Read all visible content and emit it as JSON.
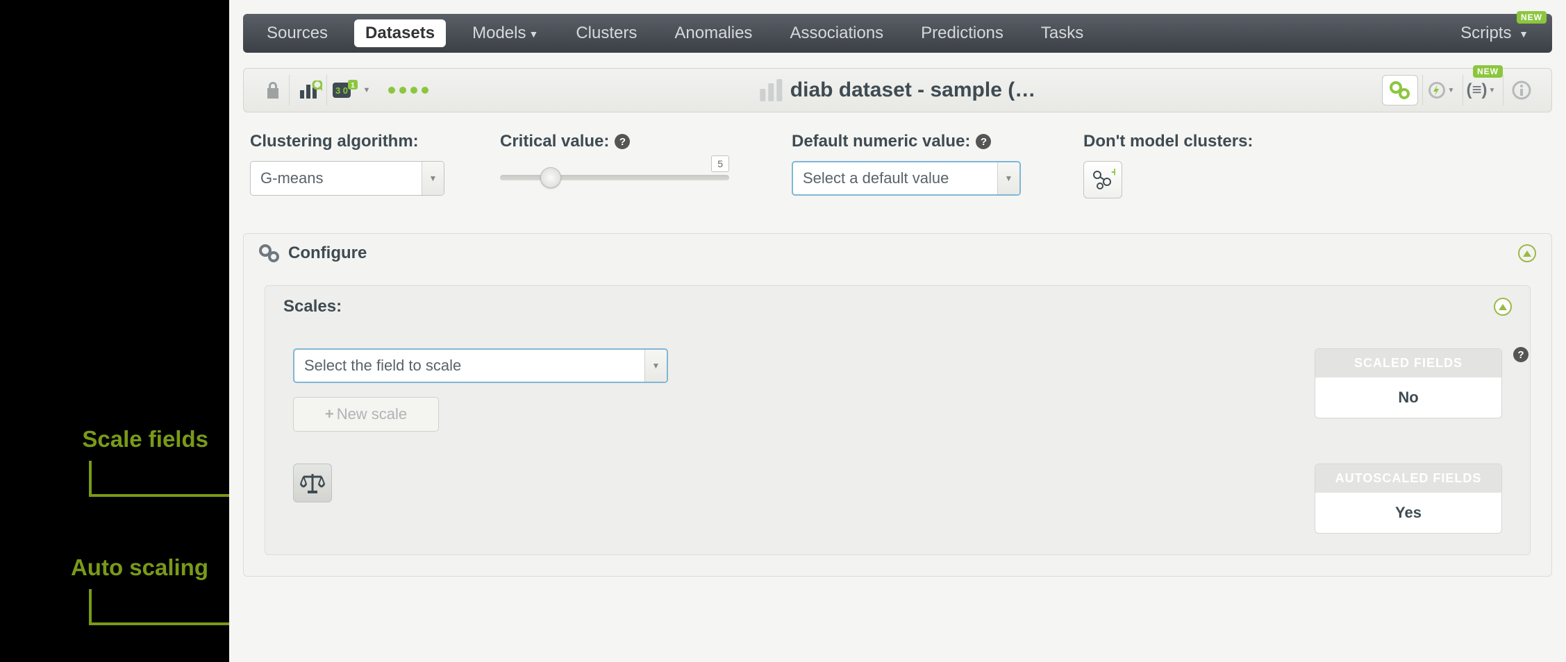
{
  "nav": {
    "tabs": [
      "Sources",
      "Datasets",
      "Models",
      "Clusters",
      "Anomalies",
      "Associations",
      "Predictions",
      "Tasks"
    ],
    "active_index": 1,
    "dropdown_indices": [
      2
    ],
    "right_tab": "Scripts",
    "new_badge": "NEW"
  },
  "toolbar": {
    "title": "diab dataset - sample (…",
    "new_badge": "NEW"
  },
  "config": {
    "algo_label": "Clustering algorithm:",
    "algo_value": "G-means",
    "critical_label": "Critical value:",
    "critical_value": "5",
    "default_label": "Default numeric value:",
    "default_placeholder": "Select a default value",
    "dont_model_label": "Don't model clusters:"
  },
  "configure_panel": {
    "title": "Configure"
  },
  "scales_panel": {
    "title": "Scales:",
    "field_placeholder": "Select the field to scale",
    "new_scale_label": "New scale",
    "scaled_head": "SCALED FIELDS",
    "scaled_value": "No",
    "autoscaled_head": "AUTOSCALED FIELDS",
    "autoscaled_value": "Yes"
  },
  "annotations": {
    "scale_fields": "Scale fields",
    "auto_scaling": "Auto scaling"
  },
  "colors": {
    "accent_green": "#8cc63f",
    "annotation_green": "#7a9a18",
    "text_dark": "#3e4b52"
  }
}
